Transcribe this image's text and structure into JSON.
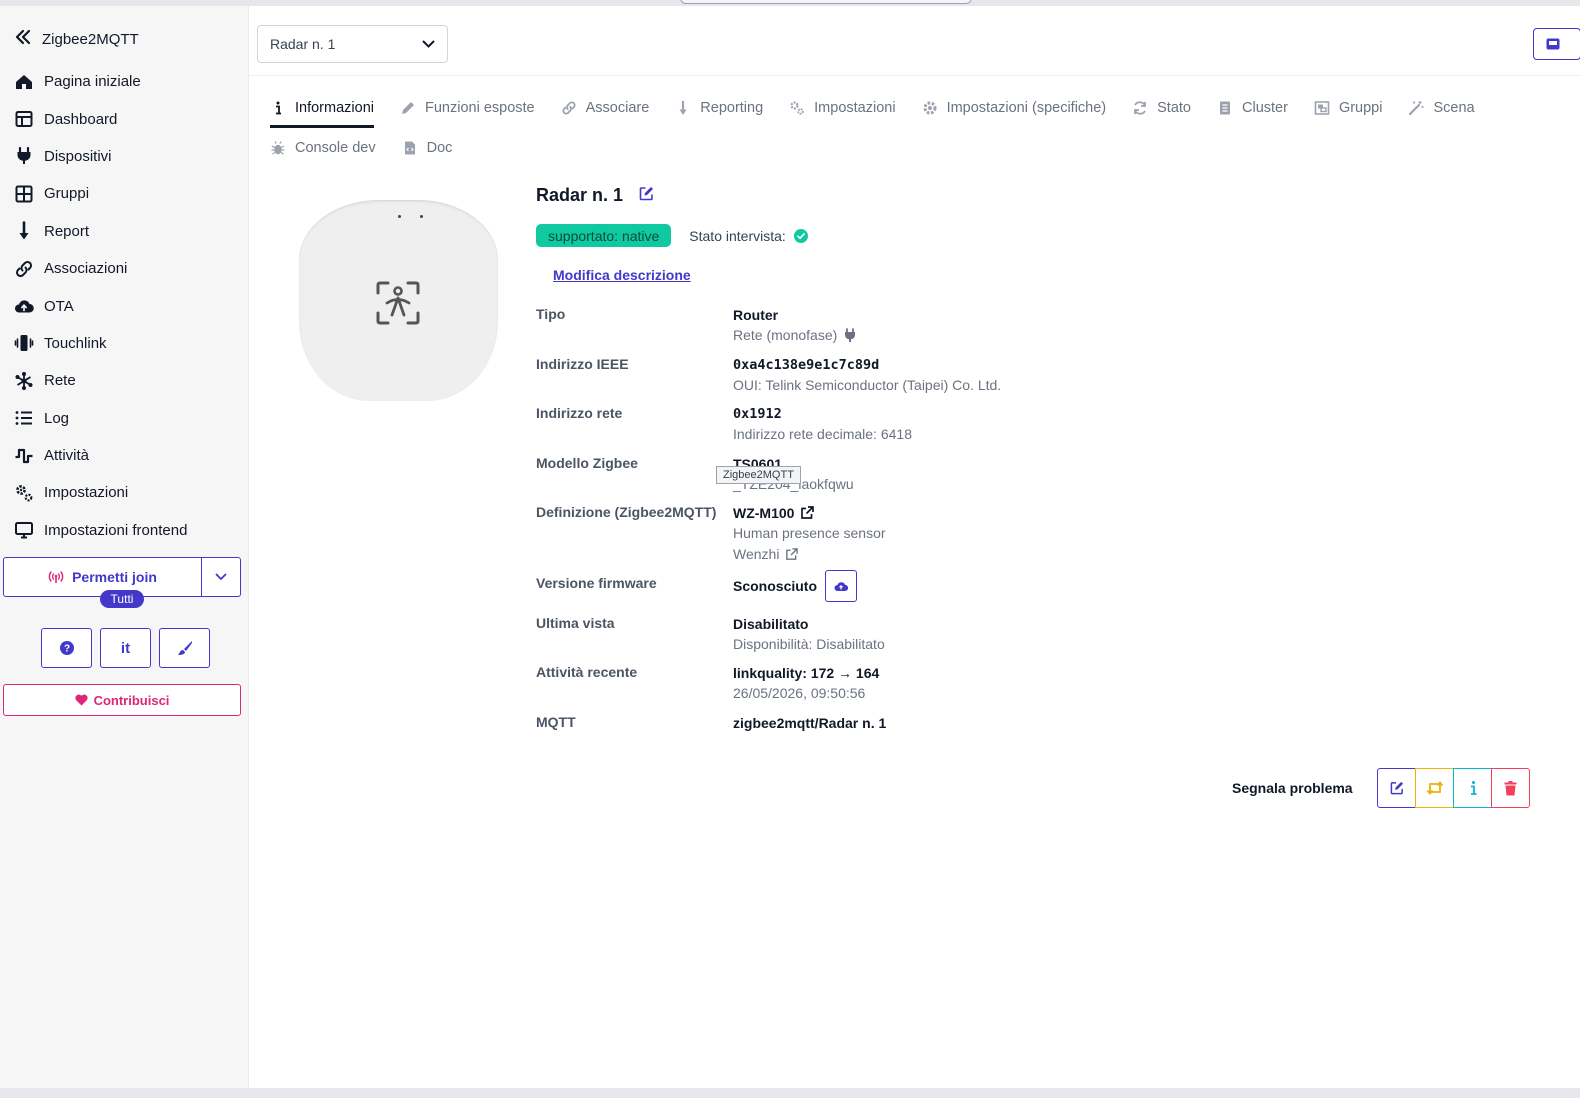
{
  "app": {
    "title": "Zigbee2MQTT"
  },
  "sidebar": {
    "items": [
      {
        "label": "Pagina iniziale",
        "icon": "home-icon"
      },
      {
        "label": "Dashboard",
        "icon": "dashboard-icon"
      },
      {
        "label": "Dispositivi",
        "icon": "plug-icon"
      },
      {
        "label": "Gruppi",
        "icon": "grid-icon"
      },
      {
        "label": "Report",
        "icon": "arrow-down-icon"
      },
      {
        "label": "Associazioni",
        "icon": "link-icon"
      },
      {
        "label": "OTA",
        "icon": "cloud-upload-icon"
      },
      {
        "label": "Touchlink",
        "icon": "touchlink-icon"
      },
      {
        "label": "Rete",
        "icon": "network-icon"
      },
      {
        "label": "Log",
        "icon": "list-icon"
      },
      {
        "label": "Attività",
        "icon": "activity-icon"
      },
      {
        "label": "Impostazioni",
        "icon": "gears-icon"
      },
      {
        "label": "Impostazioni frontend",
        "icon": "monitor-icon"
      }
    ],
    "join_label": "Permetti join",
    "join_target": "Tutti",
    "language": "it",
    "contribute_label": "Contribuisci"
  },
  "header": {
    "device_select": "Radar n. 1"
  },
  "tabs": [
    {
      "label": "Informazioni",
      "active": true
    },
    {
      "label": "Funzioni esposte"
    },
    {
      "label": "Associare"
    },
    {
      "label": "Reporting"
    },
    {
      "label": "Impostazioni"
    },
    {
      "label": "Impostazioni (specifiche)"
    },
    {
      "label": "Stato"
    },
    {
      "label": "Cluster"
    },
    {
      "label": "Gruppi"
    },
    {
      "label": "Scena"
    },
    {
      "label": "Console dev"
    },
    {
      "label": "Doc"
    }
  ],
  "device": {
    "name": "Radar n. 1",
    "support_badge": "supportato: native",
    "interview_label": "Stato intervista:",
    "edit_description": "Modifica descrizione",
    "type_label": "Tipo",
    "type_value": "Router",
    "power_value": "Rete (monofase)",
    "ieee_label": "Indirizzo IEEE",
    "ieee_value": "0xa4c138e9e1c7c89d",
    "oui_value": "OUI: Telink Semiconductor (Taipei) Co. Ltd.",
    "network_label": "Indirizzo rete",
    "network_value": "0x1912",
    "network_decimal": "Indirizzo rete decimale: 6418",
    "model_label": "Modello Zigbee",
    "model_value": "TS0601",
    "manufacturer_id": "_TZE204_laokfqwu",
    "tooltip": "Zigbee2MQTT",
    "definition_label": "Definizione (Zigbee2MQTT)",
    "definition_model": "WZ-M100",
    "definition_desc": "Human presence sensor",
    "definition_vendor": "Wenzhi",
    "firmware_label": "Versione firmware",
    "firmware_value": "Sconosciuto",
    "last_seen_label": "Ultima vista",
    "last_seen_value": "Disabilitato",
    "availability_value": "Disponibilità: Disabilitato",
    "activity_label": "Attività recente",
    "activity_value": "linkquality: 172 → 164",
    "activity_time": "26/05/2026, 09:50:56",
    "mqtt_label": "MQTT",
    "mqtt_value": "zigbee2mqtt/Radar n. 1"
  },
  "footer": {
    "report_problem": "Segnala problema"
  },
  "colors": {
    "accent": "#4338ca",
    "success": "#10c9a0",
    "pink": "#db2777",
    "warning": "#eab308",
    "info": "#06b6d4",
    "danger": "#f43f5e"
  }
}
